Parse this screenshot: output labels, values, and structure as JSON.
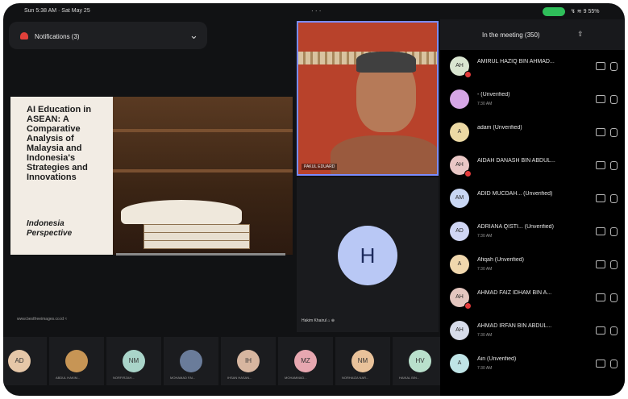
{
  "status_bar": {
    "time": "Sun 5:38 AM · Sat May 25",
    "dots": "· · ·",
    "system": "↯ ≋ 9 55%"
  },
  "notifications": {
    "label": "Notifications (3)"
  },
  "presentation": {
    "title": "AI Education in ASEAN: A Comparative Analysis of Malaysia and Indonesia's Strategies and Innovations",
    "subtitle": "Indonesia Perspective",
    "source": "www.bestfreeimages.co.id  ≈"
  },
  "video_tile": {
    "name": "PAKUL EDUARD"
  },
  "h_tile": {
    "initial": "H",
    "name": "Hakim Khairul  ⌂ ⊕"
  },
  "strip": [
    {
      "initials": "AD",
      "label": "",
      "color": "#e6c7a8"
    },
    {
      "initials": "",
      "label": "ABDUL HAKIM...",
      "color": "#c79555"
    },
    {
      "initials": "NM",
      "label": "NORFIRZAH...",
      "color": "#a9d4c9"
    },
    {
      "initials": "",
      "label": "MOHAMAD FAI...",
      "color": "#6a7c9a"
    },
    {
      "initials": "IH",
      "label": "IHSAN HASAN...",
      "color": "#d7b6a0"
    },
    {
      "initials": "MZ",
      "label": "MOHAMMAD...",
      "color": "#e7a7b0"
    },
    {
      "initials": "NM",
      "label": "NORHAIZA NAR...",
      "color": "#e9c29a"
    },
    {
      "initials": "HV",
      "label": "HAIKAL BIN...",
      "color": "#b9e0cc"
    }
  ],
  "panel": {
    "title": "In the meeting (350)",
    "participants": [
      {
        "initials": "AH",
        "name": "AMIRUL HAZIQ BIN AHMAD...",
        "time": "",
        "color": "#d9e5d0",
        "badge": true
      },
      {
        "initials": "",
        "name": "- (Unverified)",
        "time": "7:30 AM",
        "color": "#d6a6e6",
        "badge": false
      },
      {
        "initials": "A",
        "name": "adam (Unverified)",
        "time": "",
        "color": "#ecd9a4",
        "badge": false
      },
      {
        "initials": "AH",
        "name": "AIDAH DANASH BIN ABDUL...",
        "time": "",
        "color": "#e9c7c5",
        "badge": true
      },
      {
        "initials": "AM",
        "name": "ADID MUCDAH...  (Unverified)",
        "time": "",
        "color": "#c9d7f4",
        "badge": false
      },
      {
        "initials": "AD",
        "name": "ADRIANA QISTI...  (Unverified)",
        "time": "7:30 AM",
        "color": "#d0d6f4",
        "badge": false
      },
      {
        "initials": "A",
        "name": "Afiqah (Unverified)",
        "time": "7:30 AM",
        "color": "#f0d7ad",
        "badge": false
      },
      {
        "initials": "AH",
        "name": "AHMAD FAIZ IDHAM BIN A...",
        "time": "",
        "color": "#e4c6bf",
        "badge": true
      },
      {
        "initials": "AH",
        "name": "AHMAD IRFAN BIN ABDUL...",
        "time": "7:30 AM",
        "color": "#d7dcea",
        "badge": false
      },
      {
        "initials": "A",
        "name": "Ain (Unverified)",
        "time": "7:30 AM",
        "color": "#bfe4e6",
        "badge": false
      }
    ]
  }
}
